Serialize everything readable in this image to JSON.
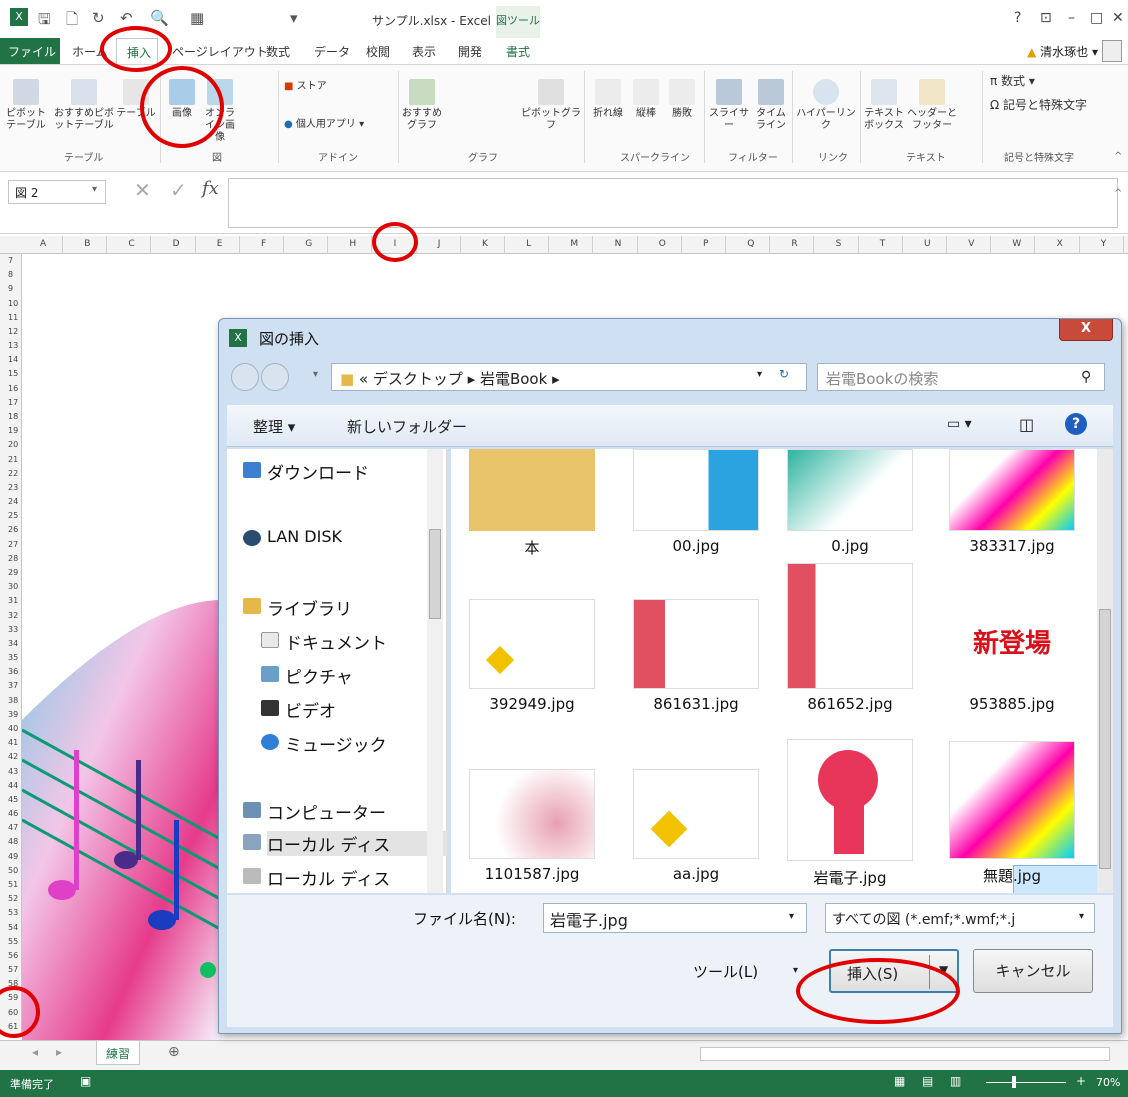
{
  "window": {
    "title": "サンプル.xlsx - Excel",
    "context_tab": "図ツール",
    "help": "?",
    "minimize": "–",
    "restore": "□",
    "close": "✕"
  },
  "tabs": [
    "ファイル",
    "ホーム",
    "挿入",
    "ページレイアウト",
    "数式",
    "データ",
    "校閲",
    "表示",
    "開発",
    "書式"
  ],
  "user": "清水琢也",
  "ribbon": {
    "buttons": [
      "ピボットテーブル",
      "おすすめピボットテーブル",
      "テーブル",
      "画像",
      "オンライン画像",
      "ストア",
      "個人用アプリ",
      "おすすめグラフ",
      "ピボットグラフ",
      "折れ線",
      "縦棒",
      "勝敗",
      "スライサー",
      "タイムライン",
      "ハイパーリンク",
      "テキストボックス",
      "ヘッダーとフッター",
      "数式",
      "記号と特殊文字"
    ],
    "groups": [
      "テーブル",
      "図",
      "アドイン",
      "グラフ",
      "スパークライン",
      "フィルター",
      "リンク",
      "テキスト",
      "記号と特殊文字"
    ]
  },
  "formula_bar": {
    "name_box": "図 2",
    "fx": "fx"
  },
  "columns": [
    "A",
    "B",
    "C",
    "D",
    "E",
    "F",
    "G",
    "H",
    "I",
    "J",
    "K",
    "L",
    "M",
    "N",
    "O",
    "P",
    "Q",
    "R",
    "S",
    "T",
    "U",
    "V",
    "W",
    "X",
    "Y"
  ],
  "rows": [
    "7",
    "8",
    "9",
    "10",
    "11",
    "12",
    "13",
    "14",
    "15",
    "16",
    "17",
    "18",
    "19",
    "20",
    "21",
    "22",
    "23",
    "24",
    "25",
    "26",
    "27",
    "28",
    "29",
    "30",
    "31",
    "32",
    "33",
    "34",
    "35",
    "36",
    "37",
    "38",
    "39",
    "40",
    "41",
    "42",
    "43",
    "44",
    "45",
    "46",
    "47",
    "48",
    "49",
    "50",
    "51",
    "52",
    "53",
    "54",
    "55",
    "56",
    "57",
    "58",
    "59",
    "60",
    "61"
  ],
  "dialog": {
    "title": "図の挿入",
    "address": "« デスクトップ ▸ 岩電Book ▸",
    "search_placeholder": "岩電Bookの検索",
    "organize": "整理 ▾",
    "new_folder": "新しいフォルダー",
    "nav": [
      "ダウンロード",
      "LAN DISK",
      "ライブラリ",
      "ドキュメント",
      "ピクチャ",
      "ビデオ",
      "ミュージック",
      "コンピューター",
      "ローカル ディス",
      "ローカル ディス"
    ],
    "files": [
      "本",
      "00.jpg",
      "0.jpg",
      "383317.jpg",
      "392949.jpg",
      "861631.jpg",
      "861652.jpg",
      "953885.jpg",
      "1101587.jpg",
      "aa.jpg",
      "岩電子.jpg",
      "無題.jpg"
    ],
    "filename_label": "ファイル名(N):",
    "filename_value": "岩電子.jpg",
    "filetype": "すべての図 (*.emf;*.wmf;*.j",
    "tools": "ツール(L)",
    "insert": "挿入(S)",
    "cancel": "キャンセル",
    "shinto": "新登場"
  },
  "sheet_tab": "練習",
  "status": {
    "ready": "準備完了",
    "zoom": "70%"
  },
  "colors": {
    "excel_green": "#217346",
    "highlight": "#e10000"
  }
}
